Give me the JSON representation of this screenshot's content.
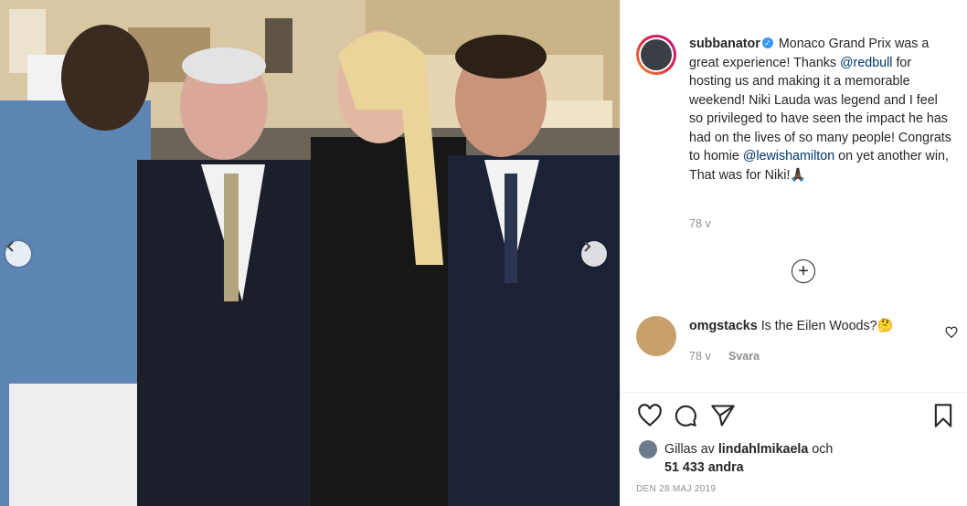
{
  "post": {
    "username": "subbanator",
    "caption_parts": {
      "p1": "Monaco Grand Prix was a great experience! Thanks ",
      "m1": "@redbull",
      "p2": " for hosting us and making it a memorable weekend! Niki Lauda was legend and I feel so privileged to have seen the impact he has had on the lives of so many people! Congrats to homie ",
      "m2": "@lewishamilton",
      "p3": " on yet another win, That was for Niki!🙏🏿"
    },
    "caption_age": "78 v",
    "verified_glyph": "✓"
  },
  "comment": {
    "username": "omgstacks",
    "text": "Is the Eilen Woods?🤔",
    "age": "78 v",
    "reply_label": "Svara"
  },
  "likes": {
    "prefix": "Gillas av",
    "user": "lindahlmikaela",
    "and": "och",
    "count": "51 433 andra"
  },
  "date": "DEN 28 MAJ 2019",
  "add_glyph": "+",
  "icons": [
    "chevron-left-icon",
    "chevron-right-icon",
    "verified-icon",
    "plus-circle-icon",
    "heart-icon",
    "comment-icon",
    "share-icon",
    "bookmark-icon"
  ],
  "colors": {
    "link": "#00376b",
    "muted": "#8e8e8e",
    "verified": "#3897f0",
    "text": "#262626"
  }
}
